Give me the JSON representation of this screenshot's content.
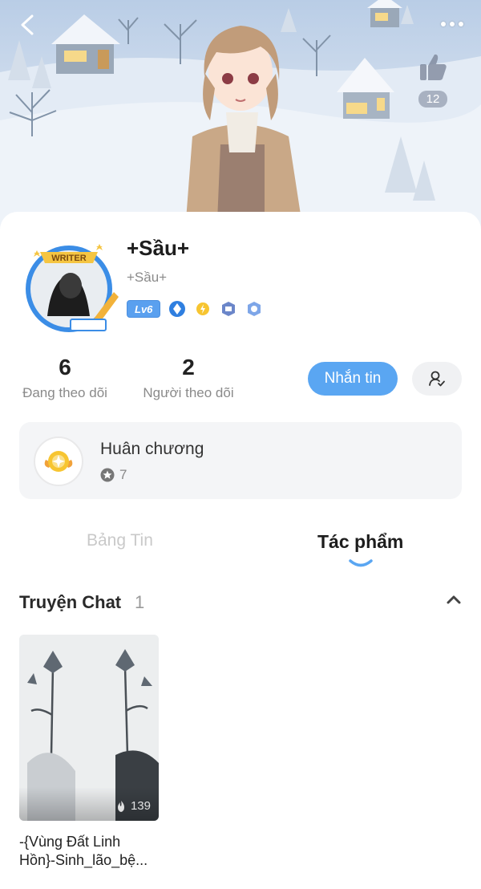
{
  "header": {
    "like_count": "12"
  },
  "profile": {
    "name": "+Sầu+",
    "handle": "+Sầu+",
    "avatar_badge_text": "WRITER",
    "level": "Lv6"
  },
  "stats": {
    "following_count": "6",
    "following_label": "Đang theo dõi",
    "followers_count": "2",
    "followers_label": "Người theo dõi"
  },
  "actions": {
    "message_label": "Nhắn tin"
  },
  "medals": {
    "title": "Huân chương",
    "count": "7"
  },
  "tabs": [
    {
      "label": "Bảng Tin",
      "active": false
    },
    {
      "label": "Tác phẩm",
      "active": true
    }
  ],
  "works_section": {
    "title": "Truyện Chat",
    "count": "1",
    "items": [
      {
        "likes": "139",
        "title_line1": "-{Vùng Đất Linh",
        "title_line2": "Hồn}-Sinh_lão_bệ..."
      }
    ]
  },
  "colors": {
    "accent": "#5aa6f2",
    "level_badge": "#5aa0ef",
    "tab_indicator": "#5aa6f2"
  }
}
